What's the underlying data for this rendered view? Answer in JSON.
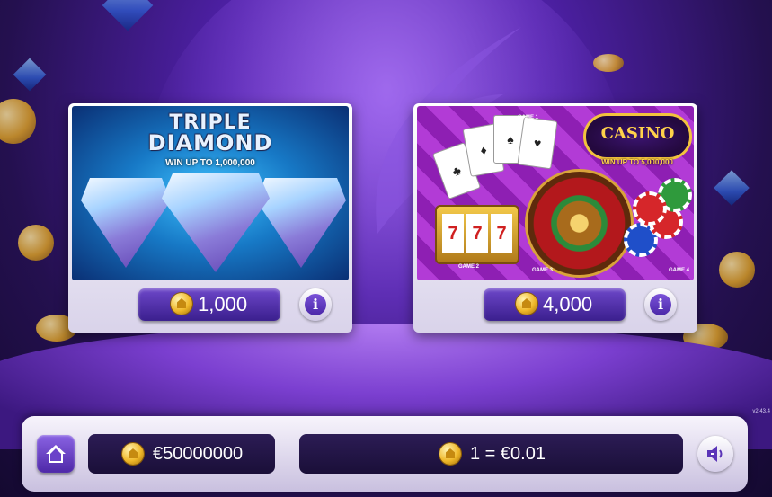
{
  "games": [
    {
      "title_line1": "TRIPLE",
      "title_line2": "DIAMOND",
      "subtitle": "WIN UP TO 1,000,000",
      "price": "1,000"
    },
    {
      "logo": "CASINO",
      "subtitle": "WIN UP TO 5,000,000",
      "labels": [
        "GAME 1",
        "GAME 2",
        "GAME 3",
        "GAME 4"
      ],
      "price": "4,000"
    }
  ],
  "bottom_bar": {
    "balance": "€50000000",
    "rate": "1 = €0.01"
  },
  "version": "v2.43.4",
  "icons": {
    "coin": "coin-icon",
    "info": "info-icon",
    "home": "home-icon",
    "sound": "sound-icon"
  }
}
